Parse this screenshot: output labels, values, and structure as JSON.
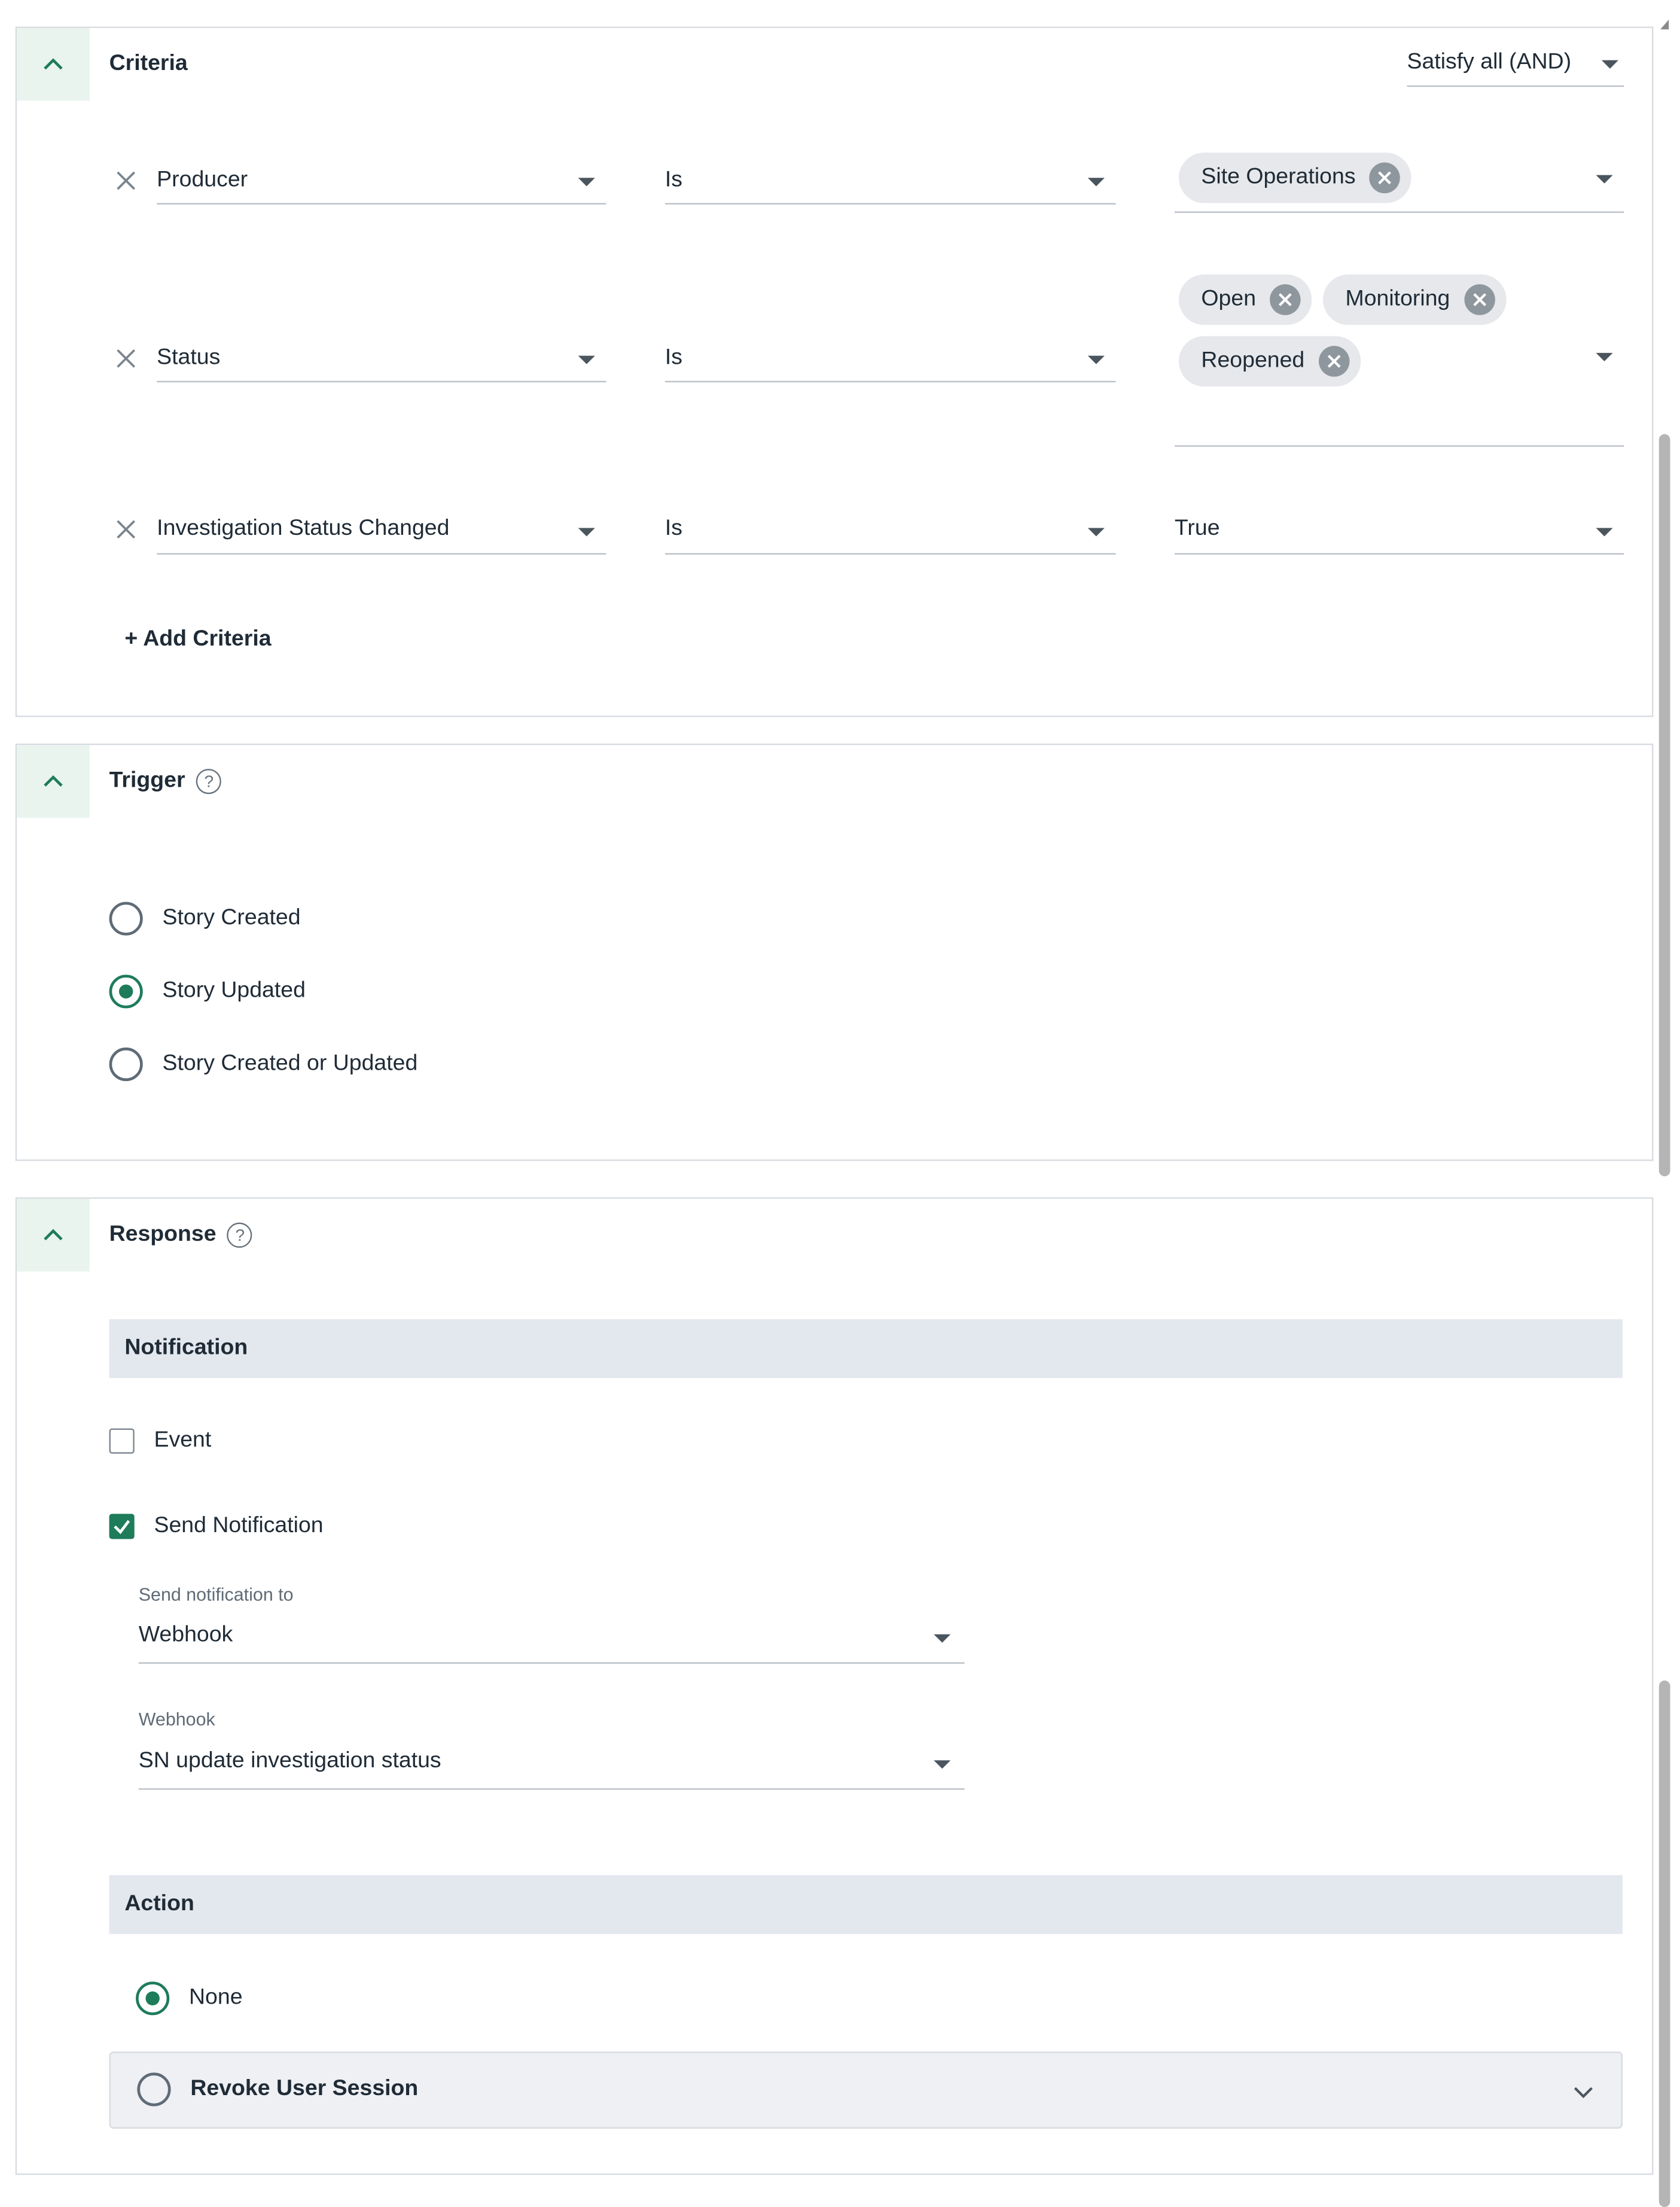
{
  "criteria": {
    "title": "Criteria",
    "match_mode": "Satisfy all (AND)",
    "rows": [
      {
        "field": "Producer",
        "operator": "Is",
        "chips": [
          "Site Operations"
        ],
        "value": ""
      },
      {
        "field": "Status",
        "operator": "Is",
        "chips": [
          "Open",
          "Monitoring",
          "Reopened"
        ],
        "value": ""
      },
      {
        "field": "Investigation Status Changed",
        "operator": "Is",
        "chips": [],
        "value": "True"
      }
    ],
    "add_label": "+ Add Criteria"
  },
  "trigger": {
    "title": "Trigger",
    "options": [
      "Story Created",
      "Story Updated",
      "Story Created or Updated"
    ],
    "selected": "Story Updated"
  },
  "response": {
    "title": "Response",
    "notification": {
      "header": "Notification",
      "event_label": "Event",
      "event_checked": false,
      "send_label": "Send Notification",
      "send_checked": true,
      "send_to_label": "Send notification to",
      "send_to_value": "Webhook",
      "webhook_label": "Webhook",
      "webhook_value": "SN update investigation status"
    },
    "action": {
      "header": "Action",
      "none_label": "None",
      "revoke_label": "Revoke User Session",
      "selected": "None"
    }
  },
  "colors": {
    "accent": "#1e7c5a",
    "band": "#e3e7ee"
  },
  "icons": {
    "collapse": "chevron-up-icon",
    "remove": "close-icon",
    "help": "help-circle-icon",
    "expand": "chevron-down-icon"
  }
}
